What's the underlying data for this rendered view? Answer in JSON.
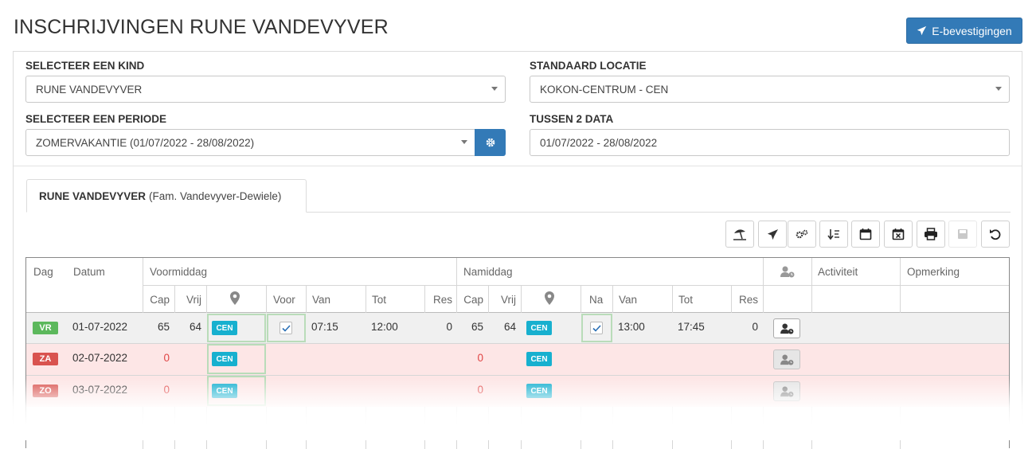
{
  "page": {
    "title": "INSCHRIJVINGEN RUNE VANDEVYVER",
    "ebevestigingen_label": "E-bevestigingen"
  },
  "form": {
    "kind_label": "SELECTEER EEN KIND",
    "kind_value": "RUNE VANDEVYVER",
    "locatie_label": "STANDAARD LOCATIE",
    "locatie_value": "KOKON-CENTRUM - CEN",
    "periode_label": "SELECTEER EEN PERIODE",
    "periode_value": "ZOMERVAKANTIE (01/07/2022 - 28/08/2022)",
    "data_label": "TUSSEN 2 DATA",
    "data_value": "01/07/2022 - 28/08/2022"
  },
  "tab": {
    "name": "RUNE VANDEVYVER",
    "family": "(Fam. Vandevyver-Dewiele)"
  },
  "toolbar": [
    "beach-umbrella-icon",
    "paper-plane-icon",
    "cogs-icon",
    "sort-numeric-icon",
    "calendar-icon",
    "calendar-x-icon",
    "print-icon",
    "save-icon",
    "undo-icon"
  ],
  "table": {
    "headers": {
      "dag": "Dag",
      "datum": "Datum",
      "voormiddag": "Voormiddag",
      "namiddag": "Namiddag",
      "activiteit": "Activiteit",
      "opmerking": "Opmerking",
      "cap": "Cap",
      "vrij": "Vrij",
      "voor": "Voor",
      "van": "Van",
      "tot": "Tot",
      "res": "Res",
      "cap2": "Cap",
      "vrij2": "Vrij",
      "na": "Na",
      "van2": "Van",
      "tot2": "Tot",
      "res2": "Res"
    },
    "rows": [
      {
        "day": "VR",
        "day_color": "#5cb85c",
        "date": "01-07-2022",
        "am_cap": "65",
        "am_vrij": "64",
        "loc": "CEN",
        "voor_checked": true,
        "am_van": "07:15",
        "am_tot": "12:00",
        "am_res": "0",
        "pm_cap": "65",
        "pm_vrij": "64",
        "loc2": "CEN",
        "na_checked": true,
        "pm_van": "13:00",
        "pm_tot": "17:45",
        "pm_res": "0"
      },
      {
        "day": "ZA",
        "day_color": "#d9534f",
        "date": "02-07-2022",
        "am_cap": "0",
        "am_vrij": "",
        "loc": "CEN",
        "voor_checked": false,
        "am_van": "",
        "am_tot": "",
        "am_res": "",
        "pm_cap": "0",
        "pm_vrij": "",
        "loc2": "CEN",
        "na_checked": false,
        "pm_van": "",
        "pm_tot": "",
        "pm_res": ""
      },
      {
        "day": "ZO",
        "day_color": "#d9534f",
        "date": "03-07-2022",
        "am_cap": "0",
        "am_vrij": "",
        "loc": "CEN",
        "voor_checked": false,
        "am_van": "",
        "am_tot": "",
        "am_res": "",
        "pm_cap": "0",
        "pm_vrij": "",
        "loc2": "CEN",
        "na_checked": false,
        "pm_van": "",
        "pm_tot": "",
        "pm_res": ""
      }
    ]
  }
}
